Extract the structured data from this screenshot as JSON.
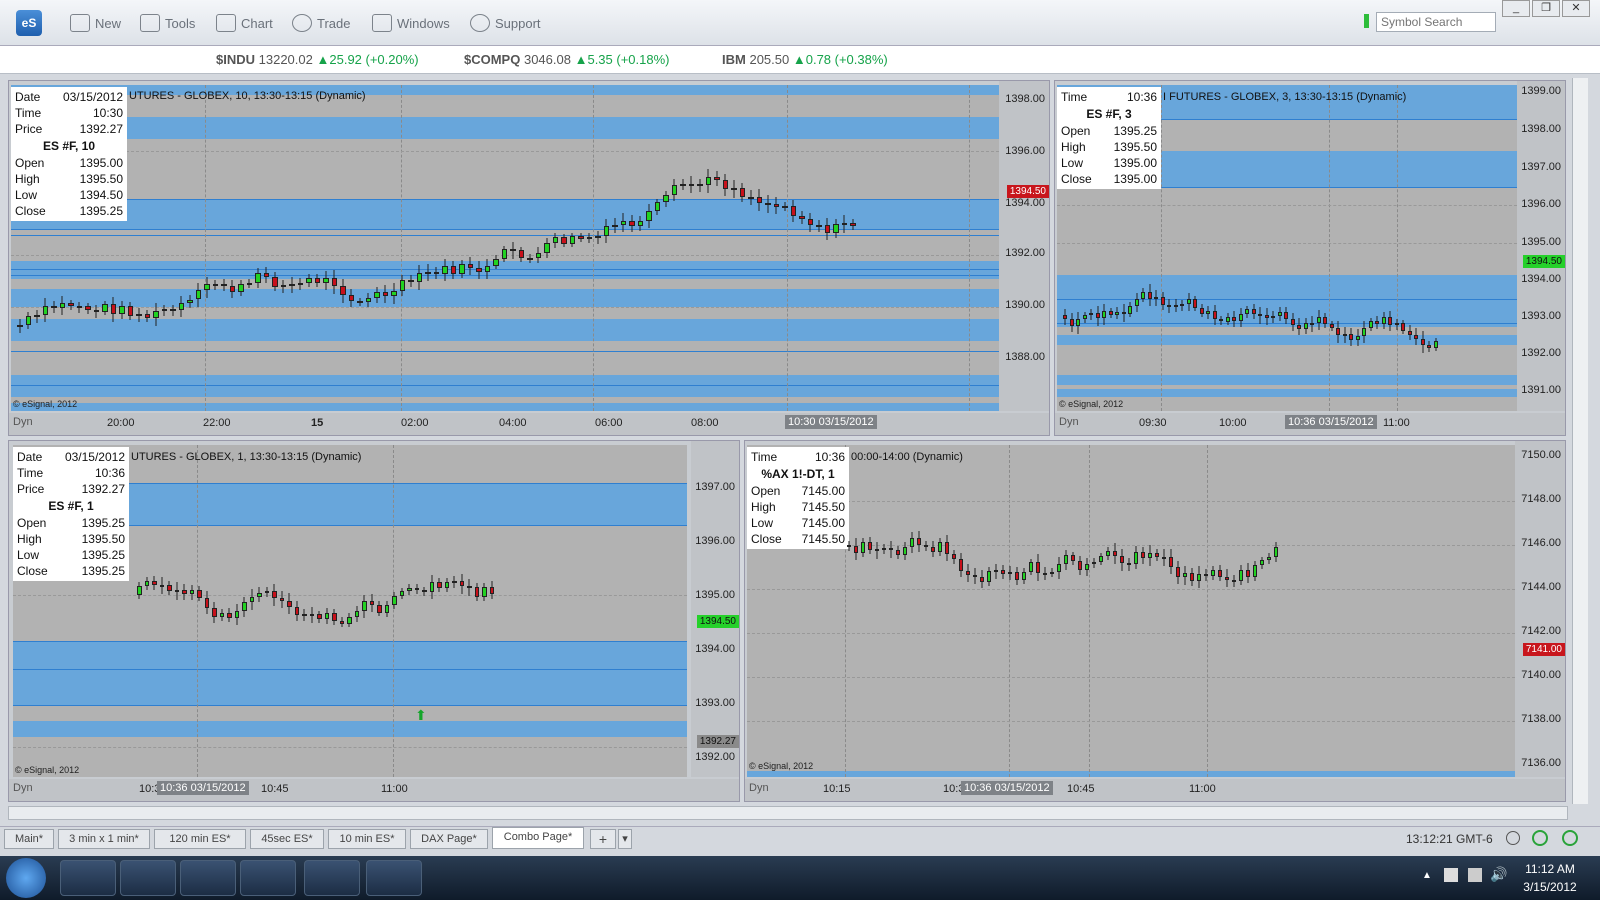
{
  "toolbar": {
    "logo": "eS",
    "buttons": [
      {
        "label": "New",
        "icon": "new-icon"
      },
      {
        "label": "Tools",
        "icon": "tools-icon"
      },
      {
        "label": "Chart",
        "icon": "chart-icon"
      },
      {
        "label": "Trade",
        "icon": "trade-icon"
      },
      {
        "label": "Windows",
        "icon": "windows-icon"
      },
      {
        "label": "Support",
        "icon": "support-icon"
      }
    ],
    "symbol_search_placeholder": "Symbol Search"
  },
  "ticker": [
    {
      "symbol": "$INDU",
      "price": "13220.02",
      "change": "▲25.92 (+0.20%)"
    },
    {
      "symbol": "$COMPQ",
      "price": "3046.08",
      "change": "▲5.35 (+0.18%)"
    },
    {
      "symbol": "IBM",
      "price": "205.50",
      "change": "▲0.78 (+0.38%)"
    }
  ],
  "colors": {
    "up": "#22d222",
    "down": "#c8101a",
    "band": "#5aa3e2",
    "plot_bg": "#b2b2b2"
  },
  "panes": {
    "p1": {
      "title": "UTURES - GLOBEX, 10, 13:30-13:15 (Dynamic)",
      "info_rows": [
        [
          "Date",
          "03/15/2012"
        ],
        [
          "Time",
          "10:30"
        ],
        [
          "Price",
          "1392.27"
        ]
      ],
      "info_title": "ES #F, 10",
      "ohlc_rows": [
        [
          "Open",
          "1395.00"
        ],
        [
          "High",
          "1395.50"
        ],
        [
          "Low",
          "1394.50"
        ],
        [
          "Close",
          "1395.25"
        ]
      ],
      "y_labels": [
        "1398.00",
        "1396.00",
        "1394.00",
        "1392.00",
        "1390.00",
        "1388.00"
      ],
      "x_labels": [
        "20:00",
        "22:00",
        "15",
        "02:00",
        "04:00",
        "06:00",
        "08:00"
      ],
      "x_cursor": "10:30 03/15/2012",
      "price_tag": "1394.50",
      "copyright": "© eSignal, 2012",
      "dyn": "Dyn"
    },
    "p2": {
      "title": "I FUTURES - GLOBEX, 3, 13:30-13:15 (Dynamic)",
      "info_rows": [
        [
          "Time",
          "10:36"
        ]
      ],
      "info_title": "ES #F, 3",
      "ohlc_rows": [
        [
          "Open",
          "1395.25"
        ],
        [
          "High",
          "1395.50"
        ],
        [
          "Low",
          "1395.00"
        ],
        [
          "Close",
          "1395.00"
        ]
      ],
      "y_labels": [
        "1399.00",
        "1398.00",
        "1397.00",
        "1396.00",
        "1395.00",
        "1394.00",
        "1393.00",
        "1392.00",
        "1391.00"
      ],
      "x_labels": [
        "09:30",
        "10:00",
        "11:00"
      ],
      "x_cursor": "10:36 03/15/2012",
      "price_tag": "1394.50",
      "copyright": "© eSignal, 2012",
      "dyn": "Dyn"
    },
    "p3": {
      "title": "UTURES - GLOBEX, 1, 13:30-13:15 (Dynamic)",
      "info_rows": [
        [
          "Date",
          "03/15/2012"
        ],
        [
          "Time",
          "10:36"
        ],
        [
          "Price",
          "1392.27"
        ]
      ],
      "info_title": "ES #F, 1",
      "ohlc_rows": [
        [
          "Open",
          "1395.25"
        ],
        [
          "High",
          "1395.50"
        ],
        [
          "Low",
          "1395.25"
        ],
        [
          "Close",
          "1395.25"
        ]
      ],
      "y_labels": [
        "1397.00",
        "1396.00",
        "1395.00",
        "1394.00",
        "1393.00",
        "1392.00"
      ],
      "x_labels": [
        "10:3",
        "10:45",
        "11:00"
      ],
      "x_cursor": "10:36 03/15/2012",
      "price_tag": "1394.50",
      "cursor_tag": "1392.27",
      "copyright": "© eSignal, 2012",
      "dyn": "Dyn"
    },
    "p4": {
      "title": "00:00-14:00 (Dynamic)",
      "info_rows": [
        [
          "Time",
          "10:36"
        ]
      ],
      "info_title": "%AX 1!-DT, 1",
      "ohlc_rows": [
        [
          "Open",
          "7145.00"
        ],
        [
          "High",
          "7145.50"
        ],
        [
          "Low",
          "7145.00"
        ],
        [
          "Close",
          "7145.50"
        ]
      ],
      "y_labels": [
        "7150.00",
        "7148.00",
        "7146.00",
        "7144.00",
        "7142.00",
        "7140.00",
        "7138.00",
        "7136.00"
      ],
      "x_labels": [
        "10:15",
        "10:3",
        "10:45",
        "11:00"
      ],
      "x_cursor": "10:36 03/15/2012",
      "price_tag": "7141.00",
      "copyright": "© eSignal, 2012",
      "dyn": "Dyn"
    }
  },
  "tabs": [
    "Main*",
    "3 min x 1 min*",
    "120 min ES*",
    "45sec ES*",
    "10 min ES*",
    "DAX Page*",
    "Combo Page*"
  ],
  "active_tab": "Combo Page*",
  "status": {
    "clock": "13:12:21 GMT-6"
  },
  "taskbar": {
    "time": "11:12 AM",
    "date": "3/15/2012"
  }
}
